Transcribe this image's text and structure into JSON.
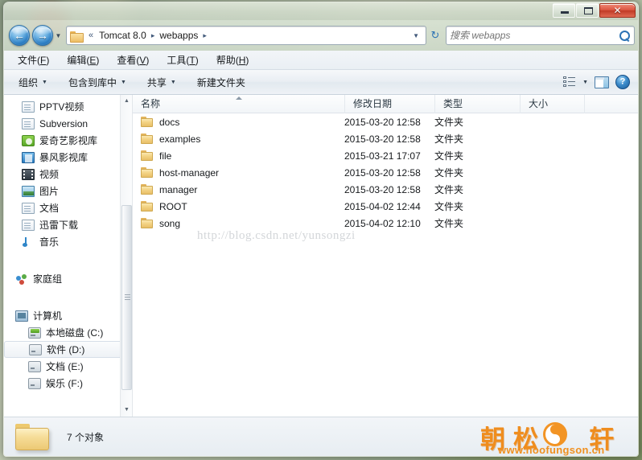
{
  "window": {
    "controls": {
      "minimize": "–",
      "maximize": "□",
      "close": "✕"
    }
  },
  "nav": {
    "back_icon": "←",
    "forward_icon": "→",
    "history_dropdown_icon": "▼",
    "breadcrumb": {
      "overflow": "«",
      "items": [
        "Tomcat 8.0",
        "webapps"
      ],
      "separator": "▸",
      "trailing": "▸"
    },
    "address_dropdown_icon": "▼",
    "refresh_icon": "↻"
  },
  "search": {
    "placeholder": "搜索 webapps",
    "value": "",
    "icon": "search-icon"
  },
  "menubar": {
    "items": [
      {
        "text": "文件",
        "accel": "F"
      },
      {
        "text": "编辑",
        "accel": "E"
      },
      {
        "text": "查看",
        "accel": "V"
      },
      {
        "text": "工具",
        "accel": "T"
      },
      {
        "text": "帮助",
        "accel": "H"
      }
    ]
  },
  "toolbar": {
    "items": [
      {
        "label": "组织",
        "has_caret": true
      },
      {
        "label": "包含到库中",
        "has_caret": true
      },
      {
        "label": "共享",
        "has_caret": true
      },
      {
        "label": "新建文件夹",
        "has_caret": false
      }
    ],
    "caret": "▼",
    "help_glyph": "?"
  },
  "sidebar": {
    "items": [
      {
        "label": "PPTV视频",
        "icon": "ic-doc",
        "kind": "item"
      },
      {
        "label": "Subversion",
        "icon": "ic-doc",
        "kind": "item"
      },
      {
        "label": "爱奇艺影视库",
        "icon": "ic-green",
        "kind": "item"
      },
      {
        "label": "暴风影视库",
        "icon": "ic-blue",
        "kind": "item"
      },
      {
        "label": "视频",
        "icon": "ic-film",
        "kind": "item"
      },
      {
        "label": "图片",
        "icon": "ic-pic",
        "kind": "item"
      },
      {
        "label": "文档",
        "icon": "ic-doc",
        "kind": "item"
      },
      {
        "label": "迅雷下载",
        "icon": "ic-doc",
        "kind": "item"
      },
      {
        "label": "音乐",
        "icon": "ic-music",
        "kind": "item"
      },
      {
        "label": "家庭组",
        "icon": "ic-home",
        "kind": "group"
      },
      {
        "label": "计算机",
        "icon": "ic-pc",
        "kind": "group"
      },
      {
        "label": "本地磁盘 (C:)",
        "icon": "ic-hdd",
        "kind": "child"
      },
      {
        "label": "软件 (D:)",
        "icon": "ic-drive",
        "kind": "child",
        "selected": true
      },
      {
        "label": "文档 (E:)",
        "icon": "ic-drive",
        "kind": "child"
      },
      {
        "label": "娱乐 (F:)",
        "icon": "ic-drive",
        "kind": "child"
      }
    ],
    "scroll_up_icon": "▲",
    "scroll_down_icon": "▼"
  },
  "filelist": {
    "columns": [
      "名称",
      "修改日期",
      "类型",
      "大小"
    ],
    "sort_column": "名称",
    "sort_direction": "ascending",
    "rows": [
      {
        "name": "docs",
        "date": "2015-03-20 12:58",
        "type": "文件夹",
        "size": ""
      },
      {
        "name": "examples",
        "date": "2015-03-20 12:58",
        "type": "文件夹",
        "size": ""
      },
      {
        "name": "file",
        "date": "2015-03-21 17:07",
        "type": "文件夹",
        "size": ""
      },
      {
        "name": "host-manager",
        "date": "2015-03-20 12:58",
        "type": "文件夹",
        "size": ""
      },
      {
        "name": "manager",
        "date": "2015-03-20 12:58",
        "type": "文件夹",
        "size": ""
      },
      {
        "name": "ROOT",
        "date": "2015-04-02 12:44",
        "type": "文件夹",
        "size": ""
      },
      {
        "name": "song",
        "date": "2015-04-02 12:10",
        "type": "文件夹",
        "size": ""
      }
    ],
    "watermark": "http://blog.csdn.net/yunsongzi"
  },
  "statusbar": {
    "text": "7 个对象"
  },
  "logo": {
    "chars": "朝松   轩",
    "url": "www.hoofungson.cn",
    "color": "#ef8d1e"
  }
}
